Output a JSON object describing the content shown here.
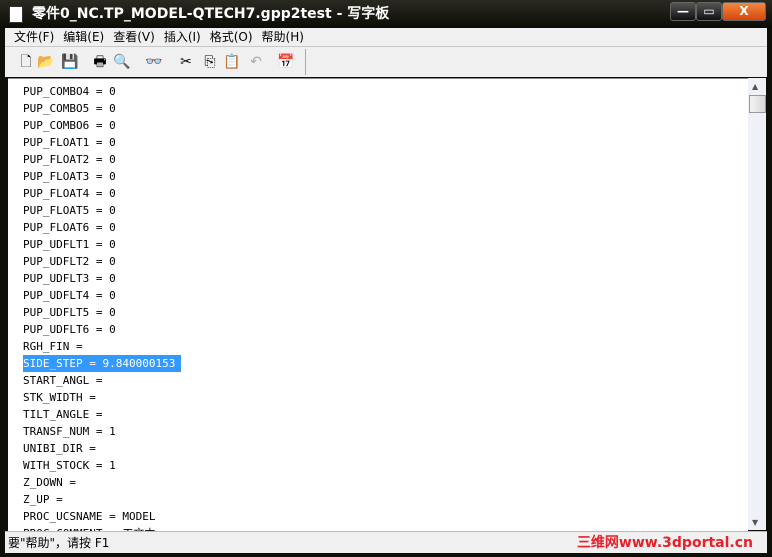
{
  "window": {
    "title": "零件0_NC.TP_MODEL-QTECH7.gpp2test - 写字板",
    "minimize": "—",
    "maximize": "▭",
    "close": "X"
  },
  "menu": [
    "文件(F)",
    "编辑(E)",
    "查看(V)",
    "插入(I)",
    "格式(O)",
    "帮助(H)"
  ],
  "toolbar": [
    {
      "icon": "new-icon",
      "glyph": "🗋"
    },
    {
      "icon": "open-icon",
      "glyph": "📂"
    },
    {
      "icon": "save-icon",
      "glyph": "💾"
    },
    {
      "icon": "print-icon",
      "glyph": "🖶"
    },
    {
      "icon": "print-preview-icon",
      "glyph": "🔍"
    },
    {
      "icon": "find-icon",
      "glyph": "👓"
    },
    {
      "icon": "cut-icon",
      "glyph": "✂"
    },
    {
      "icon": "copy-icon",
      "glyph": "⎘"
    },
    {
      "icon": "paste-icon",
      "glyph": "📋"
    },
    {
      "icon": "undo-icon",
      "glyph": "↶"
    },
    {
      "icon": "date-time-icon",
      "glyph": "📅"
    }
  ],
  "lines": [
    "PUP_COMBO4 = 0",
    "PUP_COMBO5 = 0",
    "PUP_COMBO6 = 0",
    "PUP_FLOAT1 = 0",
    "PUP_FLOAT2 = 0",
    "PUP_FLOAT3 = 0",
    "PUP_FLOAT4 = 0",
    "PUP_FLOAT5 = 0",
    "PUP_FLOAT6 = 0",
    "PUP_UDFLT1 = 0",
    "PUP_UDFLT2 = 0",
    "PUP_UDFLT3 = 0",
    "PUP_UDFLT4 = 0",
    "PUP_UDFLT5 = 0",
    "PUP_UDFLT6 = 0",
    "RGH_FIN =",
    "SIDE_STEP = 9.840000153",
    "START_ANGL =",
    "STK_WIDTH =",
    "TILT_ANGLE =",
    "TRANSF_NUM = 1",
    "UNIBI_DIR =",
    "WITH_STOCK = 1",
    "Z_DOWN =",
    "Z_UP =",
    "PROC_UCSNAME = MODEL",
    "PROC_COMMENT = 工文本"
  ],
  "selected_line": 16,
  "status": {
    "text": "要\"帮助\"，请按 F1",
    "watermark": "三维网www.3dportal.cn"
  }
}
